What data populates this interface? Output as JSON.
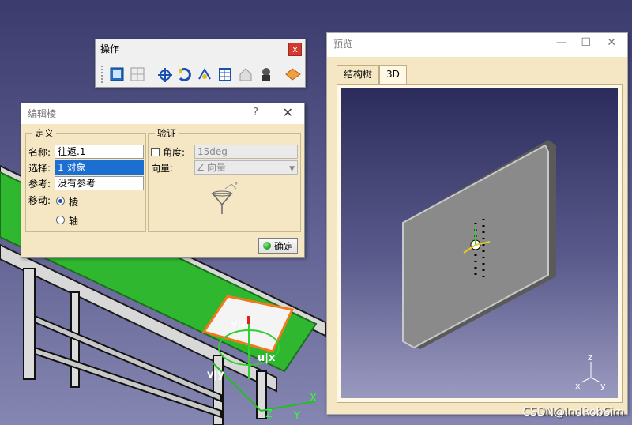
{
  "toolbar": {
    "title": "操作",
    "close": "x",
    "icons": [
      "select-body-icon",
      "grid-icon",
      "compass-axis-icon",
      "rotate-icon",
      "snap-icon",
      "table-icon",
      "home-icon",
      "robot-icon",
      "flip-icon"
    ]
  },
  "dialog": {
    "title": "编辑棱",
    "help": "?",
    "close": "✕",
    "definition": {
      "legend": "定义",
      "name_label": "名称:",
      "name_value": "往返.1",
      "select_label": "选择:",
      "select_value": "1 对象",
      "ref_label": "参考:",
      "ref_value": "没有参考",
      "move_label": "移动:",
      "move_option_edge": "棱",
      "move_option_axis": "轴",
      "move_selected": "棱"
    },
    "verify": {
      "legend": "验证",
      "angle_label": "角度:",
      "angle_value": "15deg",
      "vector_label": "向量:",
      "vector_value": "Z 向量"
    },
    "ok_label": "确定"
  },
  "preview": {
    "title": "预览",
    "minimize": "—",
    "maximize": "☐",
    "close": "✕",
    "tabs": [
      "结构树",
      "3D"
    ],
    "active_tab": "3D",
    "axis_labels": {
      "x": "x",
      "y": "y",
      "z": "z"
    }
  },
  "scene": {
    "axis_labels": {
      "x": "X",
      "y": "Y",
      "z": "Z",
      "vz": "v|z",
      "vx": "u|x",
      "vy": "v|y"
    }
  },
  "watermark": "CSDN@IndRobSim",
  "colors": {
    "belt": "#2fb82f",
    "plate": "#7e7e7e",
    "accent_blue": "#1a6fd1",
    "dialog_bg": "#f5e7c4"
  }
}
